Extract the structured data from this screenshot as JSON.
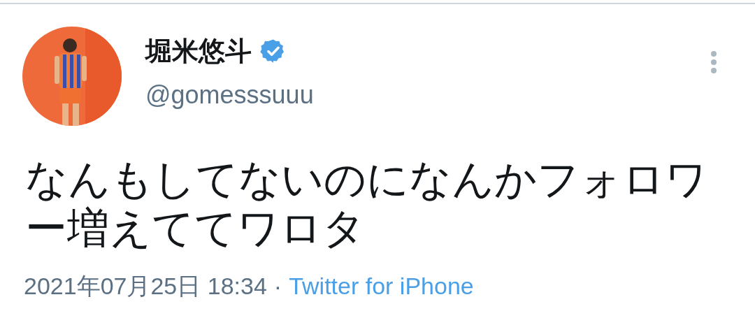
{
  "tweet": {
    "author": {
      "name": "堀米悠斗",
      "verified": true,
      "handle": "@gomesssuuu"
    },
    "text": "なんもしてないのになんかフォロワー増えててワロタ",
    "timestamp": "2021年07月25日 18:34",
    "separator": "·",
    "source": "Twitter for iPhone"
  }
}
